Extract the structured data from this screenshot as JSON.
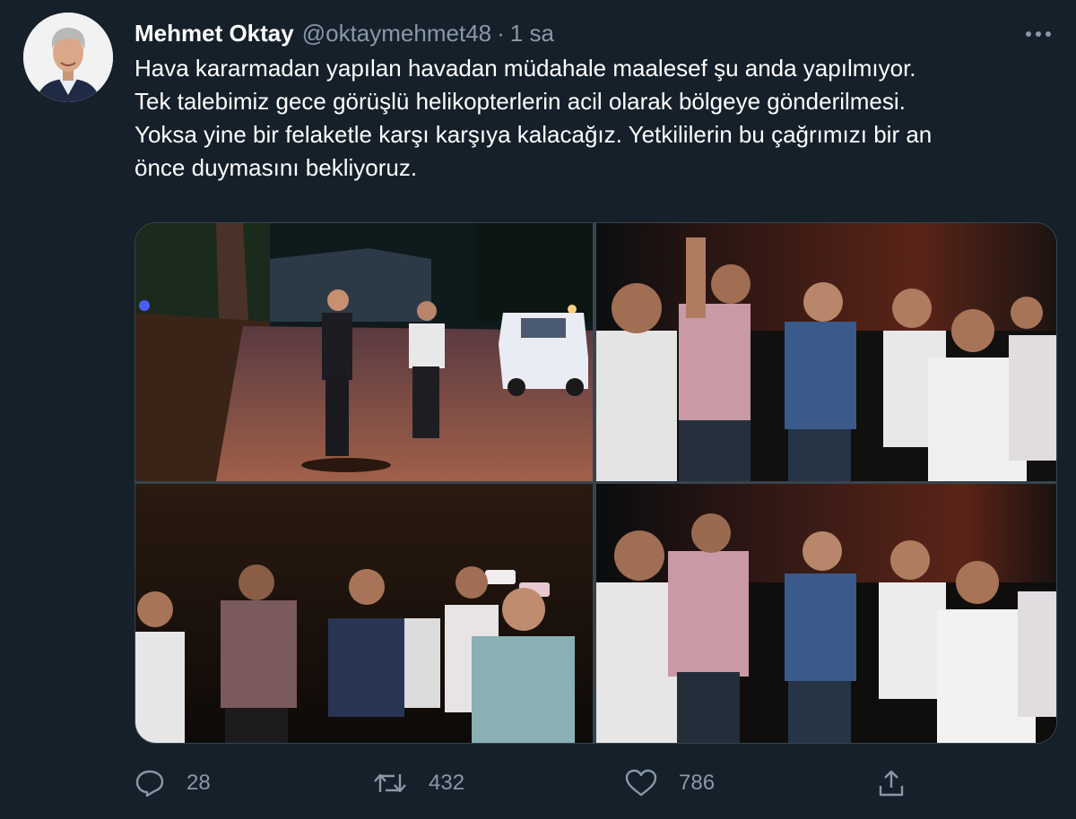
{
  "tweet": {
    "author_name": "Mehmet Oktay",
    "author_handle": "@oktaymehmet48",
    "separator": "·",
    "time": "1 sa",
    "text_lines": [
      "Hava kararmadan yapılan havadan müdahale maalesef şu anda yapılmıyor.",
      "Tek talebimiz gece görüşlü helikopterlerin acil olarak bölgeye gönderilmesi.",
      "Yoksa yine bir felaketle karşı karşıya kalacağız. Yetkililerin bu çağrımızı bir an",
      "önce duymasını bekliyoruz."
    ]
  },
  "actions": {
    "reply_count": "28",
    "retweet_count": "432",
    "like_count": "786"
  },
  "icons": {
    "more": "more-horizontal-icon",
    "reply": "reply-bubble-icon",
    "retweet": "retweet-icon",
    "like": "heart-icon",
    "share": "share-upload-icon"
  },
  "colors": {
    "background": "#15202b",
    "secondary_text": "#8899a6",
    "border": "#38444d"
  }
}
